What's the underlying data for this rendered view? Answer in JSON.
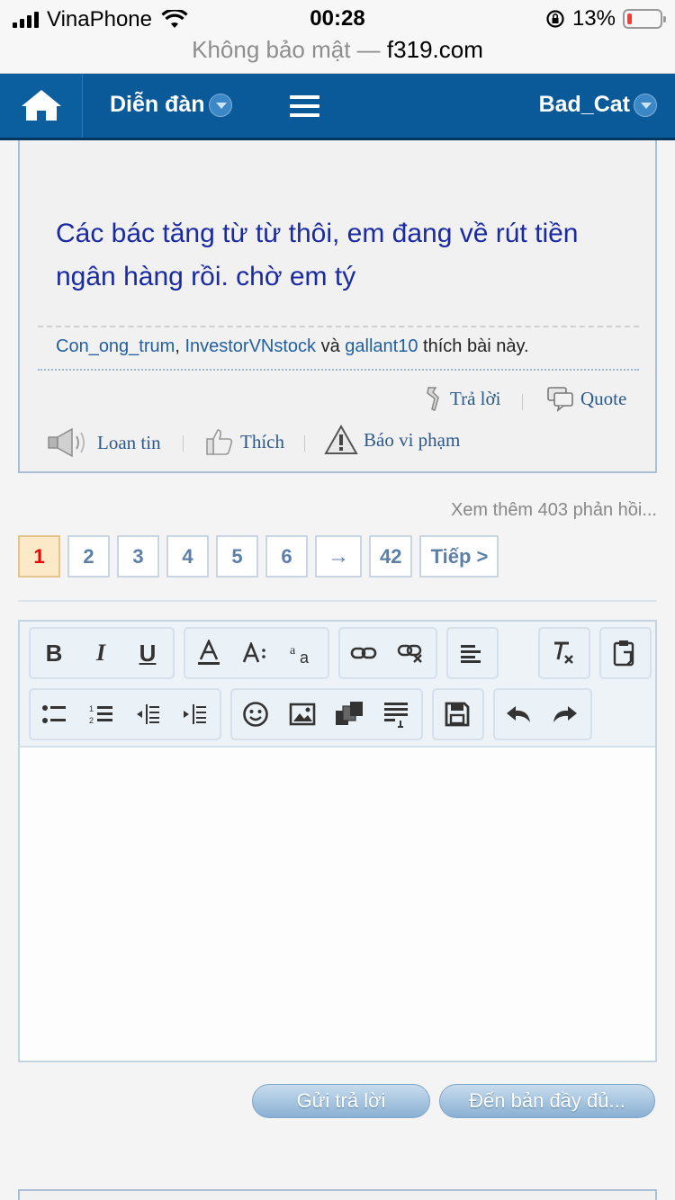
{
  "status": {
    "carrier": "VinaPhone",
    "time": "00:28",
    "battery": "13%"
  },
  "url": {
    "security": "Không bảo mật —",
    "domain": "f319.com"
  },
  "nav": {
    "forum": "Diễn đàn",
    "user": "Bad_Cat"
  },
  "post": {
    "text": "Các bác tăng từ từ thôi, em đang về rút tiền ngân hàng rồi. chờ em tý",
    "likers": [
      "Con_ong_trum",
      "InvestorVNstock",
      "gallant10"
    ],
    "comma": ",",
    "and": "và",
    "likes_suffix": "thích bài này.",
    "reply": "Trả lời",
    "quote": "Quote",
    "share": "Loan tin",
    "like": "Thích",
    "report": "Báo vi phạm"
  },
  "more_replies": "Xem thêm 403 phản hồi...",
  "pagination": {
    "pages": [
      "1",
      "2",
      "3",
      "4",
      "5",
      "6"
    ],
    "current": "1",
    "arrow": "→",
    "last": "42",
    "next": "Tiếp >"
  },
  "toolbar": {
    "row1": [
      "bold",
      "italic",
      "underline",
      "font-color",
      "font-size",
      "font-family",
      "link",
      "unlink",
      "align-left",
      "remove-format",
      "paste-text"
    ],
    "row2": [
      "bullet-list",
      "numbered-list",
      "outdent",
      "indent",
      "smilie",
      "image",
      "media",
      "code",
      "save",
      "undo",
      "redo"
    ],
    "bold": "B",
    "italic": "I",
    "underline": "U"
  },
  "buttons": {
    "submit": "Gửi trả lời",
    "full_editor": "Đến bản đầy đủ..."
  }
}
